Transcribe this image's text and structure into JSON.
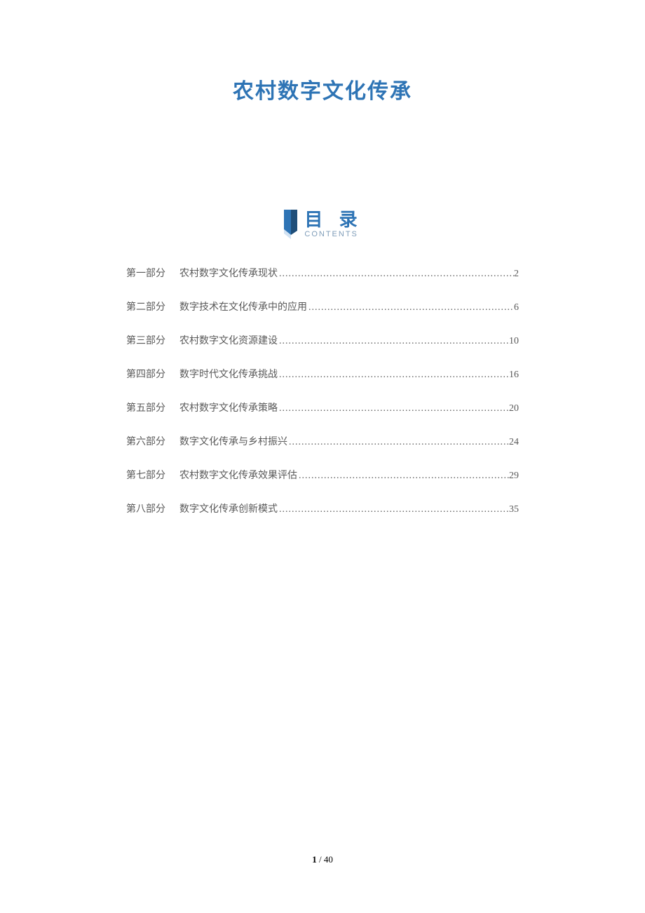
{
  "title": "农村数字文化传承",
  "toc_header": {
    "main": "目 录",
    "sub": "CONTENTS"
  },
  "toc": [
    {
      "part": "第一部分",
      "name": "农村数字文化传承现状",
      "page": "2"
    },
    {
      "part": "第二部分",
      "name": "数字技术在文化传承中的应用",
      "page": "6"
    },
    {
      "part": "第三部分",
      "name": "农村数字文化资源建设",
      "page": "10"
    },
    {
      "part": "第四部分",
      "name": "数字时代文化传承挑战",
      "page": "16"
    },
    {
      "part": "第五部分",
      "name": "农村数字文化传承策略",
      "page": "20"
    },
    {
      "part": "第六部分",
      "name": "数字文化传承与乡村振兴",
      "page": "24"
    },
    {
      "part": "第七部分",
      "name": "农村数字文化传承效果评估",
      "page": "29"
    },
    {
      "part": "第八部分",
      "name": "数字文化传承创新模式",
      "page": "35"
    }
  ],
  "footer": {
    "current": "1",
    "sep": " / ",
    "total": "40"
  }
}
